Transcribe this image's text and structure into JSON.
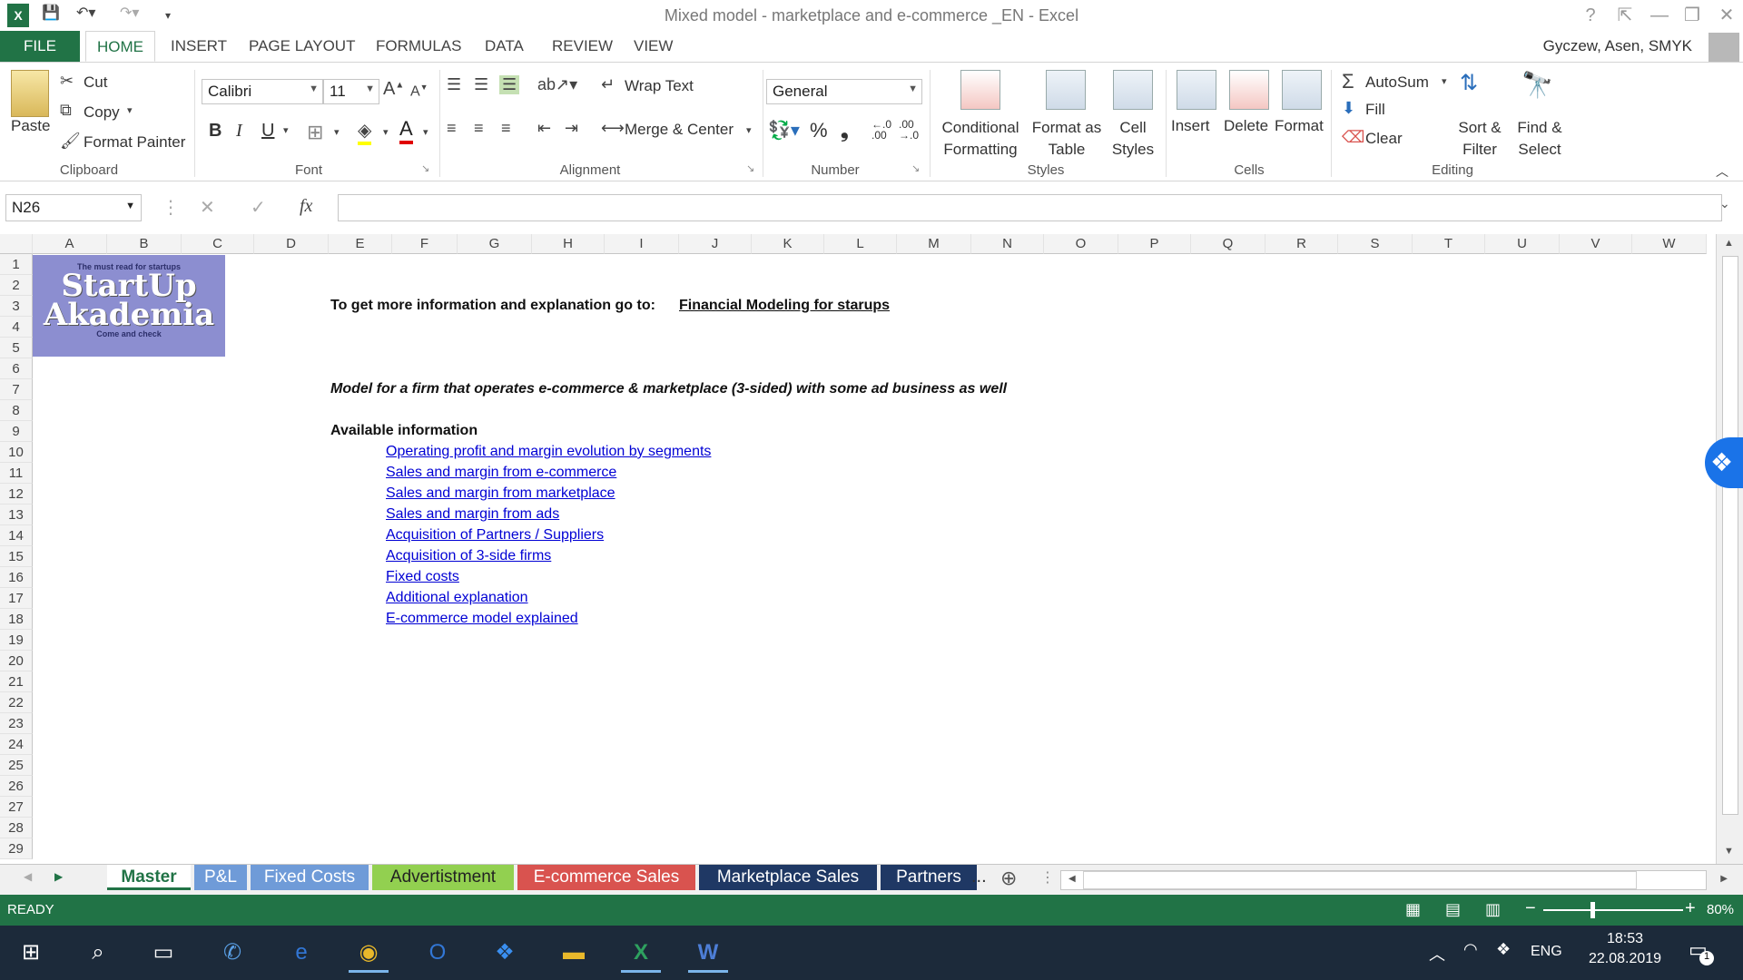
{
  "window": {
    "title": "Mixed model - marketplace and e-commerce _EN - Excel",
    "help": "?",
    "minimize": "—",
    "restore": "❐",
    "close": "✕"
  },
  "ribbon_tabs": [
    "HOME",
    "INSERT",
    "PAGE LAYOUT",
    "FORMULAS",
    "DATA",
    "REVIEW",
    "VIEW"
  ],
  "file_tab": "FILE",
  "user": "Gyczew, Asen, SMYK",
  "clipboard": {
    "paste": "Paste",
    "cut": "Cut",
    "copy": "Copy",
    "format_painter": "Format Painter",
    "label": "Clipboard"
  },
  "font": {
    "name": "Calibri",
    "size": "11",
    "bold": "B",
    "italic": "I",
    "underline": "U",
    "label": "Font"
  },
  "alignment": {
    "wrap": "Wrap Text",
    "merge": "Merge & Center",
    "label": "Alignment"
  },
  "number": {
    "format": "General",
    "percent": "%",
    "comma": "❟",
    "inc_dec": "←.0 .00",
    "dec_dec": ".00 →.0",
    "label": "Number"
  },
  "styles": {
    "conditional": [
      "Conditional",
      "Formatting"
    ],
    "format_table": [
      "Format as",
      "Table"
    ],
    "cell_styles": [
      "Cell",
      "Styles"
    ],
    "label": "Styles"
  },
  "cells": {
    "insert": "Insert",
    "delete": "Delete",
    "format": "Format",
    "label": "Cells"
  },
  "editing": {
    "autosum": "AutoSum",
    "fill": "Fill",
    "clear": "Clear",
    "sort": [
      "Sort &",
      "Filter"
    ],
    "find": [
      "Find &",
      "Select"
    ],
    "label": "Editing"
  },
  "namebox": "N26",
  "formula_value": "",
  "columns": [
    "A",
    "B",
    "C",
    "D",
    "E",
    "F",
    "G",
    "H",
    "I",
    "J",
    "K",
    "L",
    "M",
    "N",
    "O",
    "P",
    "Q",
    "R",
    "S",
    "T",
    "U",
    "V",
    "W"
  ],
  "rows": [
    "1",
    "2",
    "3",
    "4",
    "5",
    "6",
    "7",
    "8",
    "9",
    "10",
    "11",
    "12",
    "13",
    "14",
    "15",
    "16",
    "17",
    "18",
    "19",
    "20",
    "21",
    "22",
    "23",
    "24",
    "25",
    "26",
    "27",
    "28",
    "29"
  ],
  "logo": {
    "top": "The must read for startups",
    "line1": "StartUp",
    "line2": "Akademia",
    "bottom": "Come and check"
  },
  "content": {
    "info_text": "To get more information and explanation go to:",
    "info_link": "Financial Modeling for starups",
    "model_desc": "Model for a firm that operates e-commerce & marketplace (3-sided) with some ad business as well",
    "available": "Available information",
    "links": [
      "Operating profit and margin evolution by segments",
      "Sales and margin from e-commerce",
      "Sales and margin from marketplace",
      "Sales and margin from ads",
      "Acquisition of Partners / Suppliers",
      "Acquisition of 3-side firms",
      "Fixed costs",
      "Additional explanation",
      "E-commerce model explained"
    ]
  },
  "sheet_tabs": [
    {
      "name": "Master",
      "color": "#f3f3f3",
      "text": "#217346"
    },
    {
      "name": "P&L",
      "color": "#6f9bd8",
      "text": "#ffffff"
    },
    {
      "name": "Fixed Costs",
      "color": "#6f9bd8",
      "text": "#ffffff"
    },
    {
      "name": "Advertistment",
      "color": "#92d050",
      "text": "#222222"
    },
    {
      "name": "E-commerce Sales",
      "color": "#d9534f",
      "text": "#ffffff"
    },
    {
      "name": "Marketplace Sales",
      "color": "#1f3864",
      "text": "#ffffff"
    },
    {
      "name": "Partners",
      "color": "#1f3864",
      "text": "#ffffff"
    }
  ],
  "more_tabs": "...",
  "status": {
    "ready": "READY",
    "zoom": "80%"
  },
  "taskbar": {
    "lang": "ENG",
    "time": "18:53",
    "date": "22.08.2019",
    "notif": "1"
  }
}
